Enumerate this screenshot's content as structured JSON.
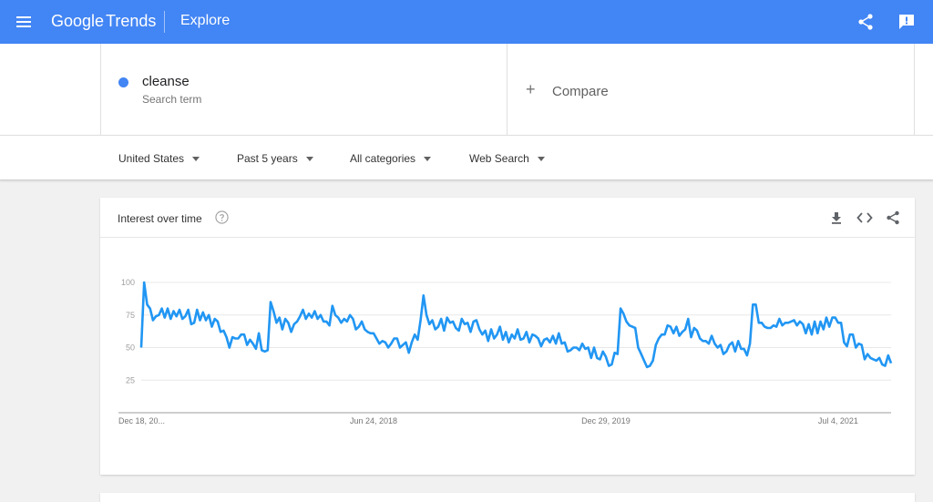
{
  "header": {
    "logo_google": "Google",
    "logo_trends": "Trends",
    "section": "Explore",
    "icons": [
      "menu-icon",
      "share-icon",
      "feedback-icon"
    ]
  },
  "colors": {
    "header_bg": "#4285f4",
    "series": "#2196f3",
    "term_dot": "#4285f4"
  },
  "term": {
    "name": "cleanse",
    "type": "Search term"
  },
  "compare": {
    "label": "Compare"
  },
  "filters": {
    "region": "United States",
    "time": "Past 5 years",
    "category": "All categories",
    "property": "Web Search"
  },
  "card": {
    "title": "Interest over time"
  },
  "chart_data": {
    "type": "line",
    "ylim": [
      0,
      100
    ],
    "yticks": [
      25,
      50,
      75,
      100
    ],
    "grid": true,
    "x_tick_labels": [
      "Dec 18, 20...",
      "Jun 24, 2018",
      "Dec 29, 2019",
      "Jul 4, 2021"
    ],
    "x_tick_weeks": [
      0,
      79,
      158,
      237
    ],
    "series": [
      {
        "values": [
          50,
          100,
          83,
          80,
          71,
          74,
          75,
          80,
          73,
          80,
          72,
          78,
          74,
          79,
          72,
          74,
          79,
          68,
          69,
          79,
          71,
          77,
          71,
          75,
          66,
          72,
          70,
          62,
          63,
          58,
          50,
          58,
          57,
          57,
          60,
          60,
          52,
          56,
          53,
          49,
          61,
          48,
          47,
          48,
          85,
          78,
          69,
          73,
          64,
          72,
          69,
          62,
          68,
          70,
          74,
          79,
          72,
          76,
          73,
          78,
          72,
          75,
          70,
          70,
          67,
          82,
          75,
          73,
          69,
          72,
          70,
          75,
          72,
          64,
          66,
          70,
          64,
          62,
          61,
          61,
          57,
          53,
          55,
          54,
          50,
          53,
          57,
          57,
          50,
          52,
          54,
          46,
          54,
          60,
          56,
          71,
          90,
          75,
          68,
          71,
          64,
          66,
          72,
          63,
          73,
          69,
          70,
          65,
          63,
          72,
          68,
          69,
          62,
          70,
          71,
          64,
          60,
          63,
          55,
          64,
          57,
          60,
          66,
          56,
          62,
          54,
          60,
          57,
          64,
          56,
          57,
          62,
          54,
          60,
          59,
          57,
          51,
          56,
          57,
          54,
          59,
          53,
          61,
          53,
          54,
          47,
          48,
          50,
          50,
          48,
          53,
          49,
          50,
          42,
          50,
          42,
          41,
          47,
          43,
          36,
          37,
          46,
          45,
          80,
          76,
          70,
          67,
          66,
          65,
          50,
          45,
          40,
          35,
          36,
          40,
          52,
          57,
          60,
          60,
          67,
          66,
          61,
          66,
          59,
          62,
          64,
          72,
          58,
          65,
          63,
          57,
          55,
          55,
          53,
          59,
          53,
          50,
          52,
          45,
          47,
          52,
          54,
          47,
          55,
          49,
          49,
          44,
          53,
          83,
          83,
          69,
          69,
          66,
          65,
          65,
          67,
          66,
          72,
          67,
          69,
          69,
          70,
          71,
          67,
          70,
          68,
          61,
          68,
          60,
          70,
          61,
          70,
          64,
          73,
          66,
          73,
          73,
          69,
          69,
          54,
          51,
          60,
          60,
          50,
          53,
          52,
          41,
          45,
          42,
          41,
          40,
          42,
          37,
          36,
          44,
          38
        ],
        "color": "#2196f3"
      }
    ]
  }
}
